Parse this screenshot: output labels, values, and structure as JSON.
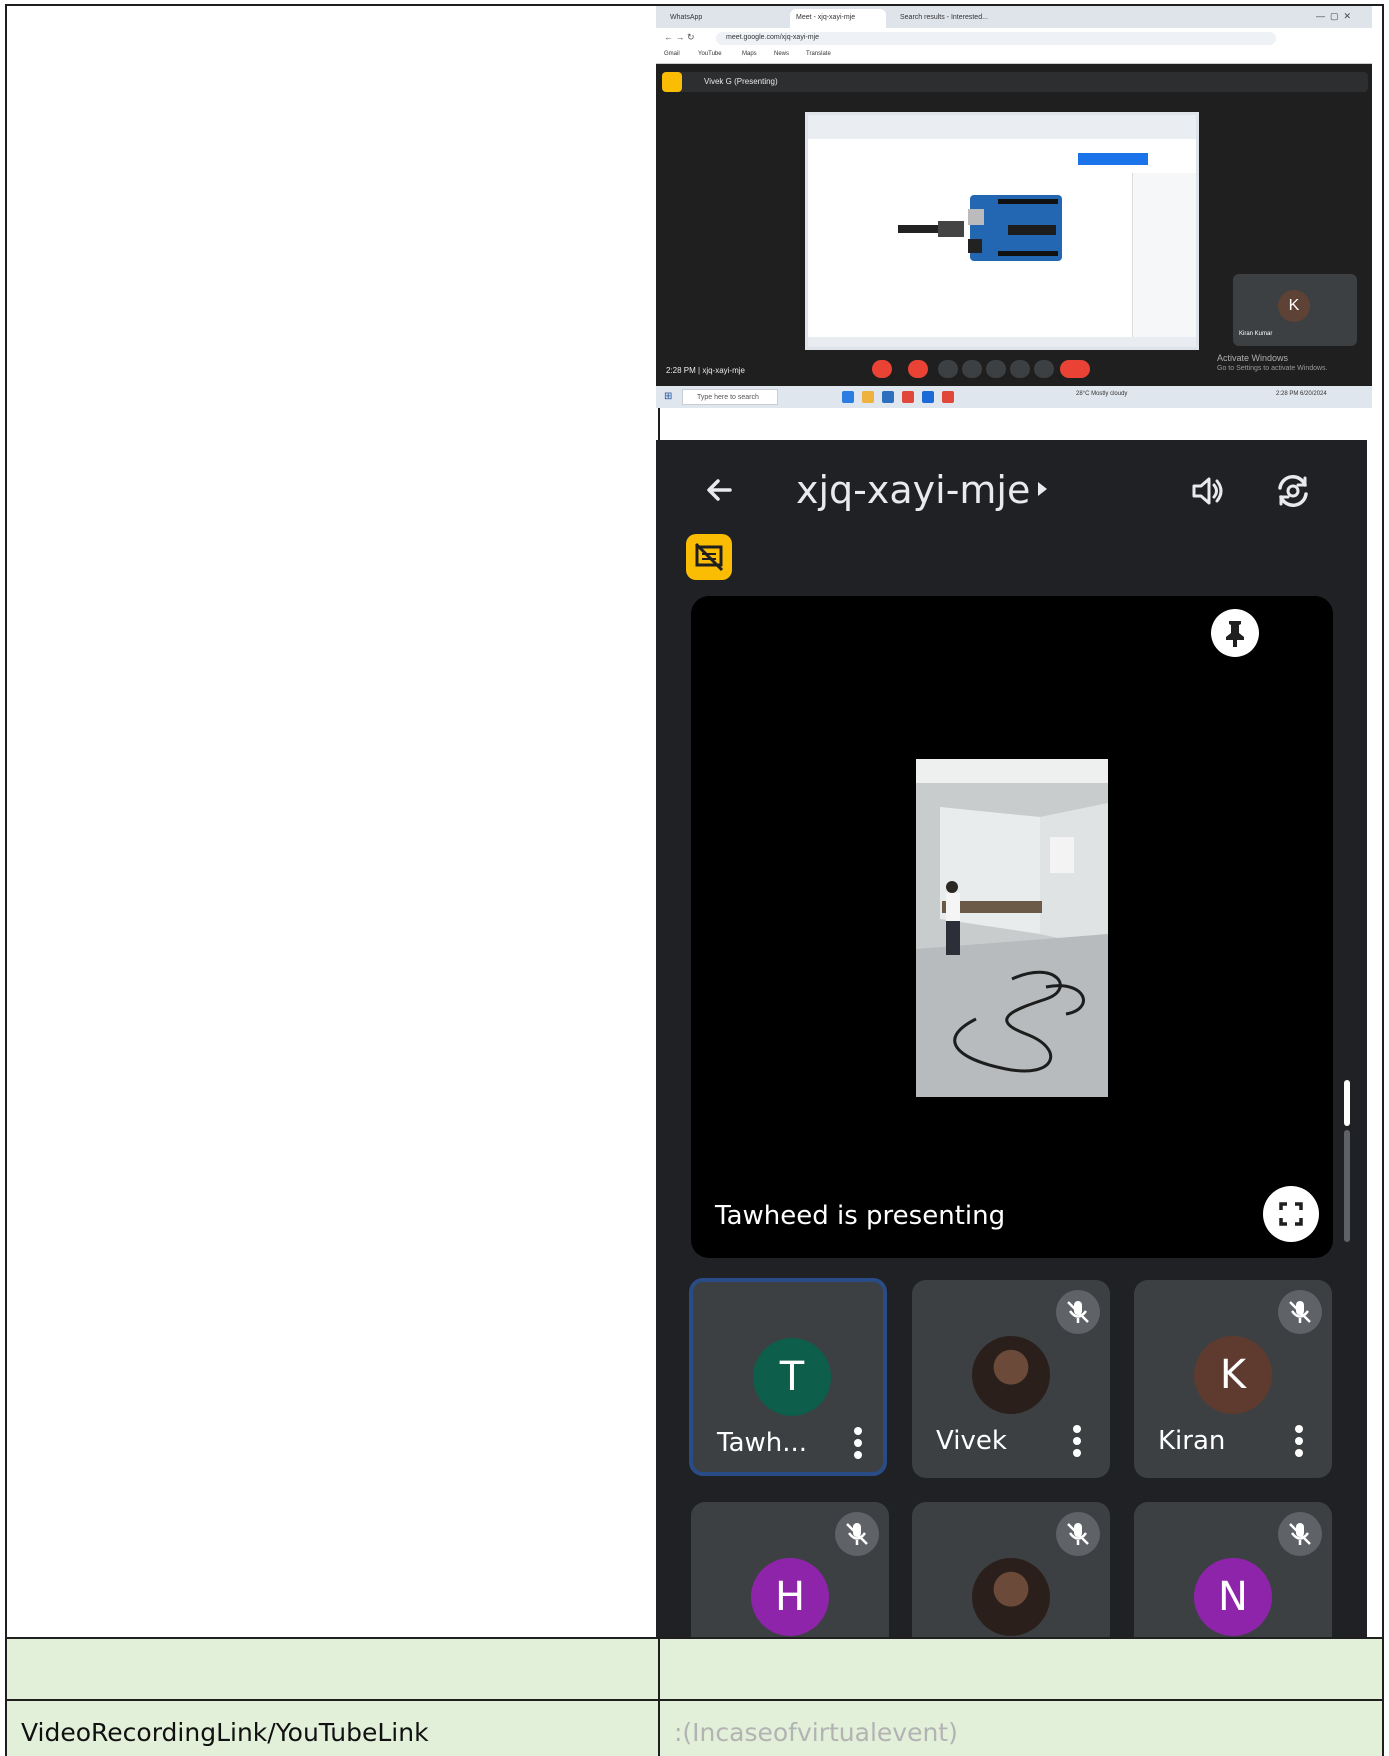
{
  "document": {
    "row_label": "VideoRecordingLink/YouTubeLink",
    "row_hint": ":(Incaseofvirtualevent)"
  },
  "desktop": {
    "tabs": [
      "WhatsApp",
      "Meet - xjq-xayi-mje",
      "Search results - Interested..."
    ],
    "url": "meet.google.com/xjq-xayi-mje",
    "bookmarks": [
      "Gmail",
      "YouTube",
      "Maps",
      "News",
      "Translate"
    ],
    "presenter_label": "Vivek G (Presenting)",
    "side_tile_initial": "K",
    "side_tile_name": "Kiran Kumar",
    "time_code": "2:28 PM  |  xjq-xayi-mje",
    "activate_title": "Activate Windows",
    "activate_sub": "Go to Settings to activate Windows.",
    "search_placeholder": "Type here to search",
    "weather": "28°C  Mostly cloudy",
    "clock": "2:28 PM  6/20/2024"
  },
  "phone": {
    "meeting_code": "xjq-xayi-mje",
    "presenting_text": "Tawheed is presenting",
    "participants": [
      {
        "initial": "T",
        "name": "Tawh...",
        "color": "#0d5e4a"
      },
      {
        "initial": "",
        "name": "Vivek",
        "color": "#3a2a22"
      },
      {
        "initial": "K",
        "name": "Kiran",
        "color": "#5f3a2f"
      },
      {
        "initial": "H",
        "name": "",
        "color": "#8e24aa"
      },
      {
        "initial": "",
        "name": "",
        "color": "#2a1f1b"
      },
      {
        "initial": "N",
        "name": "",
        "color": "#8e24aa"
      }
    ]
  }
}
